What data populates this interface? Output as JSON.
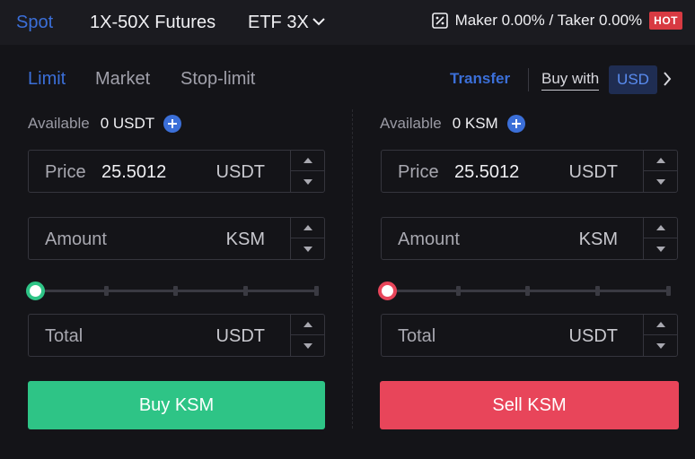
{
  "colors": {
    "accent": "#3b6fd8",
    "buy": "#2ec486",
    "sell": "#e8455a",
    "hot": "#d83a42"
  },
  "top_tabs": [
    {
      "label": "Spot",
      "active": true
    },
    {
      "label": "1X-50X Futures"
    },
    {
      "label": "ETF 3X",
      "icon": "chevron-down-icon"
    }
  ],
  "fees": {
    "label": "Maker 0.00% / Taker 0.00%",
    "badge": "HOT",
    "icon": "fee-icon"
  },
  "order_tabs": [
    {
      "label": "Limit",
      "active": true
    },
    {
      "label": "Market"
    },
    {
      "label": "Stop-limit"
    }
  ],
  "transfer_label": "Transfer",
  "buy_with": {
    "label": "Buy with",
    "currency": "USD",
    "icon": "chevron-right-icon"
  },
  "buy": {
    "available_label": "Available",
    "available_value": "0 USDT",
    "price": {
      "label": "Price",
      "value": "25.5012",
      "unit": "USDT"
    },
    "amount": {
      "label": "Amount",
      "value": "",
      "unit": "KSM"
    },
    "total": {
      "label": "Total",
      "value": "",
      "unit": "USDT"
    },
    "slider_percent": 0,
    "button_label": "Buy KSM"
  },
  "sell": {
    "available_label": "Available",
    "available_value": "0 KSM",
    "price": {
      "label": "Price",
      "value": "25.5012",
      "unit": "USDT"
    },
    "amount": {
      "label": "Amount",
      "value": "",
      "unit": "KSM"
    },
    "total": {
      "label": "Total",
      "value": "",
      "unit": "USDT"
    },
    "slider_percent": 0,
    "button_label": "Sell KSM"
  }
}
